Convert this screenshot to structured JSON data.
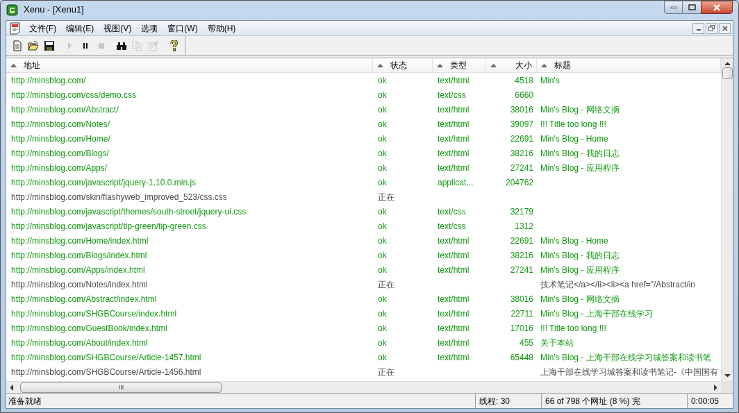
{
  "window": {
    "title": "Xenu - [Xenu1]"
  },
  "menu": [
    "文件(F)",
    "编辑(E)",
    "视图(V)",
    "选项",
    "窗口(W)",
    "帮助(H)"
  ],
  "toolbar": [
    {
      "kind": "new",
      "disabled": false
    },
    {
      "kind": "open",
      "disabled": false
    },
    {
      "kind": "save",
      "disabled": false
    },
    {
      "kind": "play",
      "disabled": true
    },
    {
      "kind": "pause",
      "disabled": false
    },
    {
      "kind": "stop",
      "disabled": true
    },
    {
      "kind": "find",
      "disabled": false
    },
    {
      "kind": "copy",
      "disabled": true
    },
    {
      "kind": "properties",
      "disabled": true
    },
    {
      "kind": "help",
      "disabled": false
    }
  ],
  "table": {
    "columns": [
      "地址",
      "状态",
      "类型",
      "大小",
      "标题"
    ],
    "rows": [
      {
        "done": true,
        "cells": [
          "http://minsblog.com/",
          "ok",
          "text/html",
          "4518",
          "Min's"
        ]
      },
      {
        "done": true,
        "cells": [
          "http://minsblog.com/css/demo.css",
          "ok",
          "text/css",
          "6660",
          ""
        ]
      },
      {
        "done": true,
        "cells": [
          "http://minsblog.com/Abstract/",
          "ok",
          "text/html",
          "38016",
          "Min's Blog - 网络文摘"
        ]
      },
      {
        "done": true,
        "cells": [
          "http://minsblog.com/Notes/",
          "ok",
          "text/html",
          "39097",
          "!!! Title too long !!!"
        ]
      },
      {
        "done": true,
        "cells": [
          "http://minsblog.com/Home/",
          "ok",
          "text/html",
          "22691",
          "Min's Blog - Home"
        ]
      },
      {
        "done": true,
        "cells": [
          "http://minsblog.com/Blogs/",
          "ok",
          "text/html",
          "38216",
          "Min's Blog - 我的日志"
        ]
      },
      {
        "done": true,
        "cells": [
          "http://minsblog.com/Apps/",
          "ok",
          "text/html",
          "27241",
          "Min's Blog - 应用程序"
        ]
      },
      {
        "done": true,
        "cells": [
          "http://minsblog.com/javascript/jquery-1.10.0.min.js",
          "ok",
          "applicat...",
          "204762",
          ""
        ]
      },
      {
        "done": false,
        "cells": [
          "http://minsblog.com/skin/flashyweb_improved_523/css.css",
          "正在",
          "",
          "",
          ""
        ]
      },
      {
        "done": true,
        "cells": [
          "http://minsblog.com/javascript/themes/south-street/jquery-ui.css",
          "ok",
          "text/css",
          "32179",
          ""
        ]
      },
      {
        "done": true,
        "cells": [
          "http://minsblog.com/javascript/tip-green/tip-green.css",
          "ok",
          "text/css",
          "1312",
          ""
        ]
      },
      {
        "done": true,
        "cells": [
          "http://minsblog.com/Home/index.html",
          "ok",
          "text/html",
          "22691",
          "Min's Blog - Home"
        ]
      },
      {
        "done": true,
        "cells": [
          "http://minsblog.com/Blogs/index.html",
          "ok",
          "text/html",
          "38216",
          "Min's Blog - 我的日志"
        ]
      },
      {
        "done": true,
        "cells": [
          "http://minsblog.com/Apps/index.html",
          "ok",
          "text/html",
          "27241",
          "Min's Blog - 应用程序"
        ]
      },
      {
        "done": false,
        "cells": [
          "http://minsblog.com/Notes/index.html",
          "正在",
          "",
          "",
          "技术笔记</a></li><li><a href=\"/Abstract/in"
        ]
      },
      {
        "done": true,
        "cells": [
          "http://minsblog.com/Abstract/index.html",
          "ok",
          "text/html",
          "38016",
          "Min's Blog - 网络文摘"
        ]
      },
      {
        "done": true,
        "cells": [
          "http://minsblog.com/SHGBCourse/index.html",
          "ok",
          "text/html",
          "22711",
          "Min's Blog - 上海干部在线学习"
        ]
      },
      {
        "done": true,
        "cells": [
          "http://minsblog.com/GuestBook/index.html",
          "ok",
          "text/html",
          "17016",
          "!!! Title too long !!!"
        ]
      },
      {
        "done": true,
        "cells": [
          "http://minsblog.com/About/index.html",
          "ok",
          "text/html",
          "455",
          "关于本站"
        ]
      },
      {
        "done": true,
        "cells": [
          "http://minsblog.com/SHGBCourse/Article-1457.html",
          "ok",
          "text/html",
          "65448",
          "Min's Blog - 上海干部在线学习城答案和读书笔"
        ]
      },
      {
        "done": false,
        "cells": [
          "http://minsblog.com/SHGBCourse/Article-1456.html",
          "正在",
          "",
          "",
          "上海干部在线学习城答案和读书笔记-《中国国有"
        ]
      }
    ]
  },
  "status_bar": {
    "message": "准备就绪",
    "threads": "线程: 30",
    "progress": "66 of 798 个网址 (8 %) 完",
    "elapsed": "0:00:05"
  }
}
